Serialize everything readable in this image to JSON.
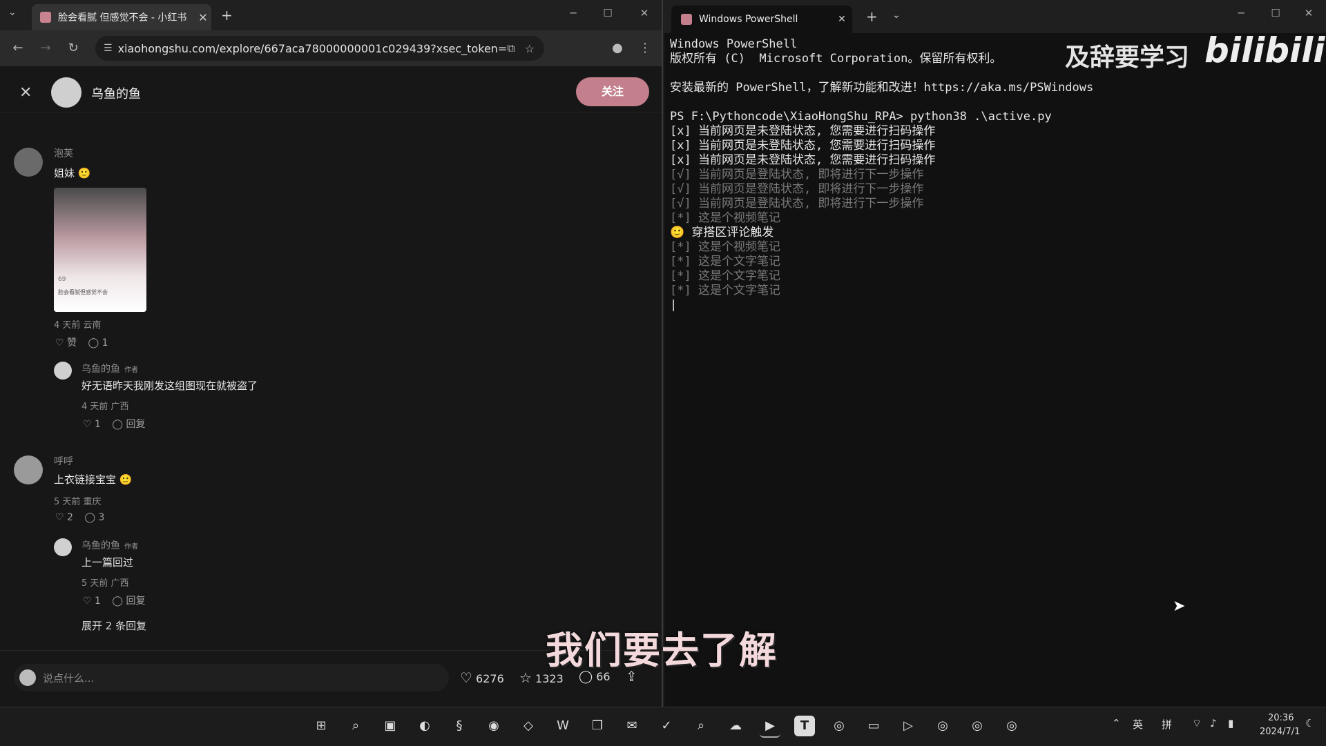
{
  "browser": {
    "tab_title": "脸会看腻 但感觉不会 - 小红书",
    "url": "xiaohongshu.com/explore/667aca78000000001c029439?xsec_token=ABv5J-_Y...",
    "post_header": {
      "author": "乌鱼的鱼",
      "follow_label": "关注"
    },
    "comments": [
      {
        "user": "泡芙",
        "text": "姐妹",
        "meta": "4 天前 云南",
        "like": "赞",
        "reply_count": "1",
        "image": {
          "likes": "69",
          "caption": "脸会看腻但感觉不会",
          "likes_label": "69",
          "visible_lines": "脸会看腻但感觉不会 ..."
        },
        "reply": {
          "user": "乌鱼的鱼",
          "tag": "作者",
          "text": "好无语昨天我刚发这组图现在就被盗了",
          "meta": "4 天前 广西",
          "likes": "1",
          "reply_label": "回复"
        }
      },
      {
        "user": "呼呼",
        "text": "上衣链接宝宝",
        "meta": "5 天前 重庆",
        "likes": "2",
        "reply_count": "3",
        "reply": {
          "user": "乌鱼的鱼",
          "tag": "作者",
          "text": "上一篇回过",
          "meta": "5 天前 广西",
          "likes": "1",
          "reply_label": "回复"
        },
        "expand_label": "展开 2 条回复"
      }
    ],
    "footer": {
      "placeholder": "说点什么...",
      "likes": "6276",
      "stars": "1323",
      "comments": "66"
    }
  },
  "terminal": {
    "tab_title": "Windows PowerShell",
    "lines": [
      {
        "text": "Windows PowerShell",
        "style": "bright"
      },
      {
        "text": "版权所有 (C)  Microsoft Corporation。保留所有权利。",
        "style": "bright"
      },
      {
        "text": "",
        "style": "bright"
      },
      {
        "text": "安装最新的 PowerShell，了解新功能和改进！https://aka.ms/PSWindows",
        "style": "bright"
      },
      {
        "text": "",
        "style": "bright"
      },
      {
        "text": "PS F:\\Pythoncode\\XiaoHongShu_RPA> python38 .\\active.py",
        "style": "bright"
      },
      {
        "text": "[x] 当前网页是未登陆状态, 您需要进行扫码操作",
        "style": "bright"
      },
      {
        "text": "[x] 当前网页是未登陆状态, 您需要进行扫码操作",
        "style": "bright"
      },
      {
        "text": "[x] 当前网页是未登陆状态, 您需要进行扫码操作",
        "style": "bright"
      },
      {
        "text": "[√] 当前网页是登陆状态, 即将进行下一步操作",
        "style": "dim"
      },
      {
        "text": "[√] 当前网页是登陆状态, 即将进行下一步操作",
        "style": "dim"
      },
      {
        "text": "[√] 当前网页是登陆状态, 即将进行下一步操作",
        "style": "dim"
      },
      {
        "text": "[*] 这是个视频笔记",
        "style": "dim"
      },
      {
        "text": "🙂 穿搭区评论触发",
        "style": "bright"
      },
      {
        "text": "[*] 这是个视频笔记",
        "style": "dim"
      },
      {
        "text": "[*] 这是个文字笔记",
        "style": "dim"
      },
      {
        "text": "[*] 这是个文字笔记",
        "style": "dim"
      },
      {
        "text": "[*] 这是个文字笔记",
        "style": "dim"
      }
    ]
  },
  "watermark": {
    "channel": "及辞要学习",
    "site": "bilibili"
  },
  "subtitle": "我们要去了解",
  "taskbar": {
    "ime_lang": "英",
    "ime_mode": "拼",
    "time": "20:36",
    "date": "2024/7/1"
  },
  "colors": {
    "follow_button": "#c47f8c",
    "terminal_bg": "#111111",
    "browser_bg": "#171717"
  }
}
